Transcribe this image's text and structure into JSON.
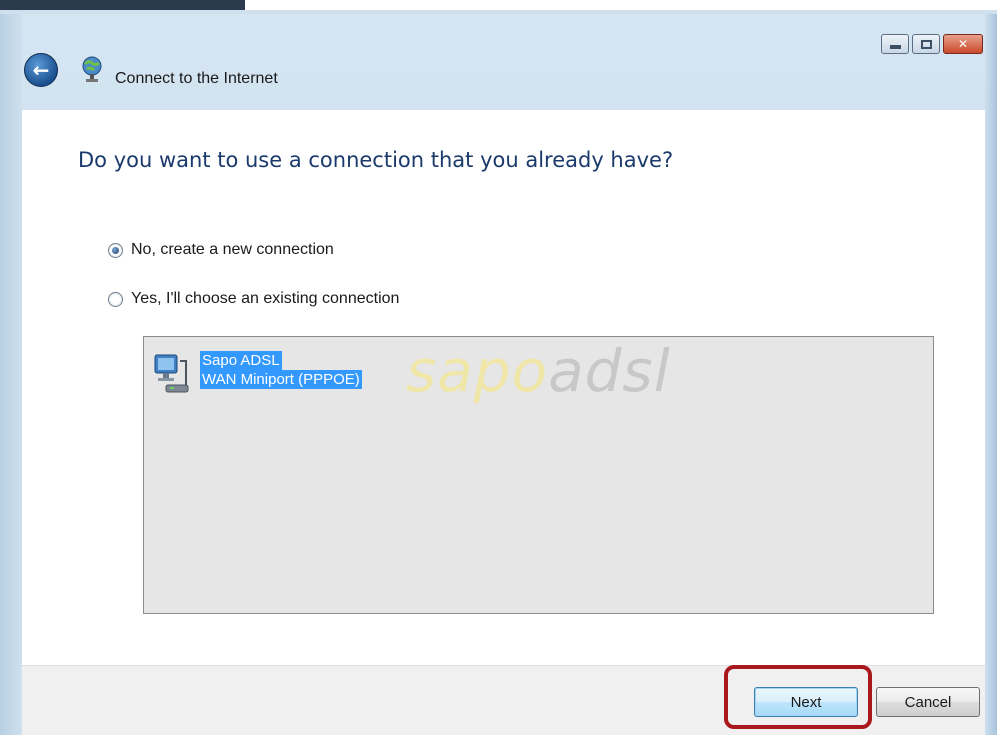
{
  "window": {
    "title": "Connect to the Internet",
    "caption_buttons": [
      "minimize-icon",
      "maximize-icon",
      "close-icon"
    ]
  },
  "main": {
    "heading": "Do you want to use a connection that you already have?",
    "options": [
      {
        "label": "No, create a new connection",
        "selected": true
      },
      {
        "label": "Yes, I'll choose an existing connection",
        "selected": false
      }
    ],
    "connections": [
      {
        "name": "Sapo ADSL",
        "device": "WAN Miniport (PPPOE)",
        "icon": "network-connection-icon",
        "selected": true
      }
    ],
    "watermark": {
      "part1": "sapo",
      "part2": "adsl"
    }
  },
  "footer": {
    "next_label": "Next",
    "cancel_label": "Cancel",
    "highlight_color": "#a8181c"
  },
  "colors": {
    "selection": "#3399ff",
    "heading": "#1a3a6c"
  }
}
